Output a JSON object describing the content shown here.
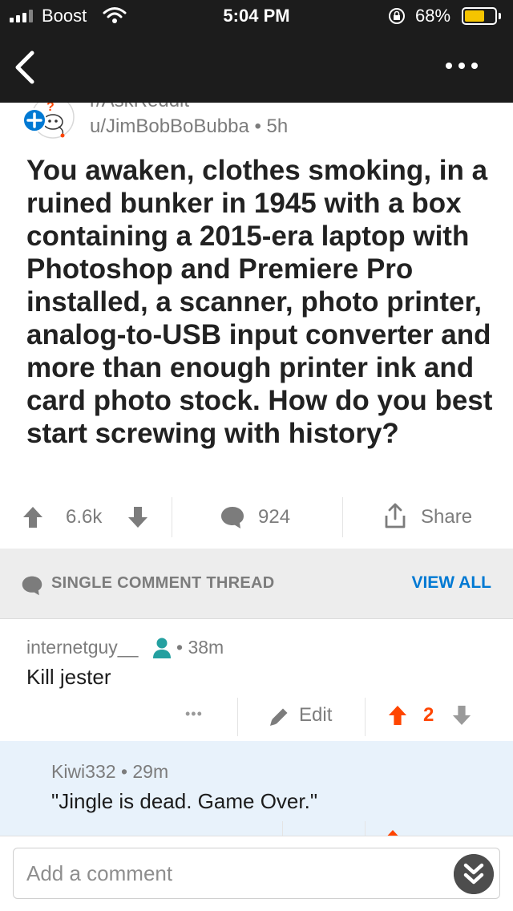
{
  "status_bar": {
    "carrier": "Boost",
    "time": "5:04 PM",
    "battery_pct": "68%",
    "battery_level": 0.68
  },
  "post": {
    "subreddit": "r/AskReddit",
    "author": "u/JimBobBoBubba",
    "age": "5h",
    "title": "You awaken, clothes smoking, in a ruined bunker in 1945 with a box containing a 2015-era laptop with Photoshop and Premiere Pro installed, a scanner, photo printer, analog-to-USB input converter and more than enough printer ink and card photo stock. How do you best start screwing with history?",
    "votes": "6.6k",
    "comments": "924",
    "share_label": "Share"
  },
  "thread": {
    "label": "SINGLE COMMENT THREAD",
    "view_all": "VIEW ALL"
  },
  "comments": [
    {
      "author": "internetguy__",
      "age": "38m",
      "body": "Kill jester",
      "more": "•••",
      "edit_label": "Edit",
      "score": "2"
    },
    {
      "author": "Kiwi332",
      "age": "29m",
      "body": "\"Jingle is dead. Game Over.\""
    }
  ],
  "composer": {
    "placeholder": "Add a comment"
  },
  "colors": {
    "upvote": "#ff4500",
    "link": "#0079d3",
    "op_badge": "#24a0a0",
    "reply_bg": "#e8f2fb"
  }
}
